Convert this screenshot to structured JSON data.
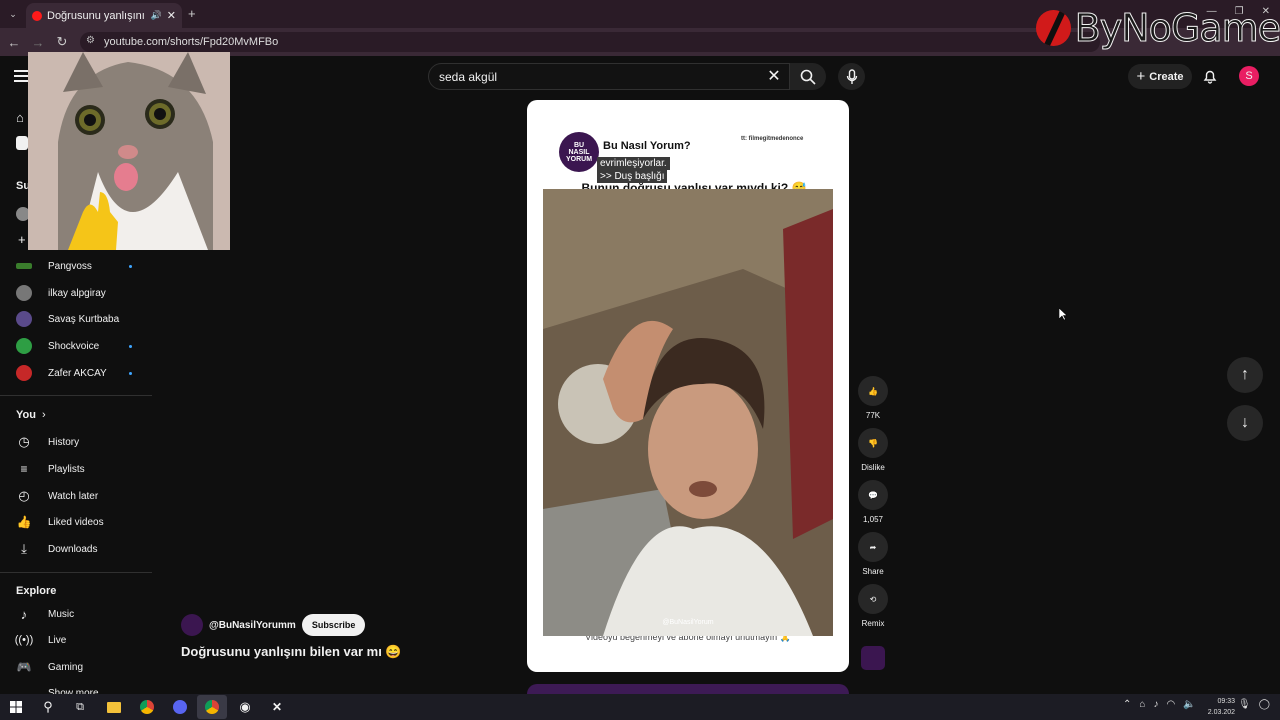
{
  "browser": {
    "tab_title": "Doğrusunu yanlışını bilen v",
    "url": "youtube.com/shorts/Fpd20MvMFBo"
  },
  "watermark": {
    "text": "ByNoGame"
  },
  "header": {
    "search_value": "seda akgül",
    "create_label": "Create",
    "avatar_letter": "S"
  },
  "sidebar": {
    "partial_head": "Su",
    "channels": [
      {
        "name": "Pangvoss",
        "new": true,
        "color": "#3a7d2c"
      },
      {
        "name": "ilkay alpgiray",
        "new": false,
        "color": "#777777"
      },
      {
        "name": "Savaş Kurtbaba",
        "new": false,
        "color": "#5a4a8a"
      },
      {
        "name": "Shockvoice",
        "new": true,
        "color": "#2e9e44"
      },
      {
        "name": "Zafer AKCAY",
        "new": true,
        "color": "#c62828"
      }
    ],
    "you_label": "You",
    "you_items": [
      "History",
      "Playlists",
      "Watch later",
      "Liked videos",
      "Downloads"
    ],
    "explore_label": "Explore",
    "explore_items": [
      "Music",
      "Live",
      "Gaming"
    ],
    "show_more": "Show more"
  },
  "short": {
    "brand_name": "Bu Nasıl Yorum?",
    "tiktok_handle": "tt: filmegitmedenonce",
    "caption_line1": "evrimleşiyorlar.",
    "caption_line2": ">> Duş başlığı",
    "headline": "Bunun doğrusu yanlışı var mıydı ki? 😅",
    "video_watermark": "@BuNasilYorum",
    "footer_note": "Videoyu beğenmeyi ve abone olmayı unutmayın 🙏",
    "channel_handle": "@BuNasilYorumm",
    "subscribe_label": "Subscribe",
    "title": "Doğrusunu yanlışını bilen var mı 😄"
  },
  "actions": {
    "likes": "77K",
    "dislike_label": "Dislike",
    "comments": "1,057",
    "share_label": "Share",
    "remix_label": "Remix"
  },
  "taskbar": {
    "time": "09:33",
    "date": "2.03.202"
  }
}
